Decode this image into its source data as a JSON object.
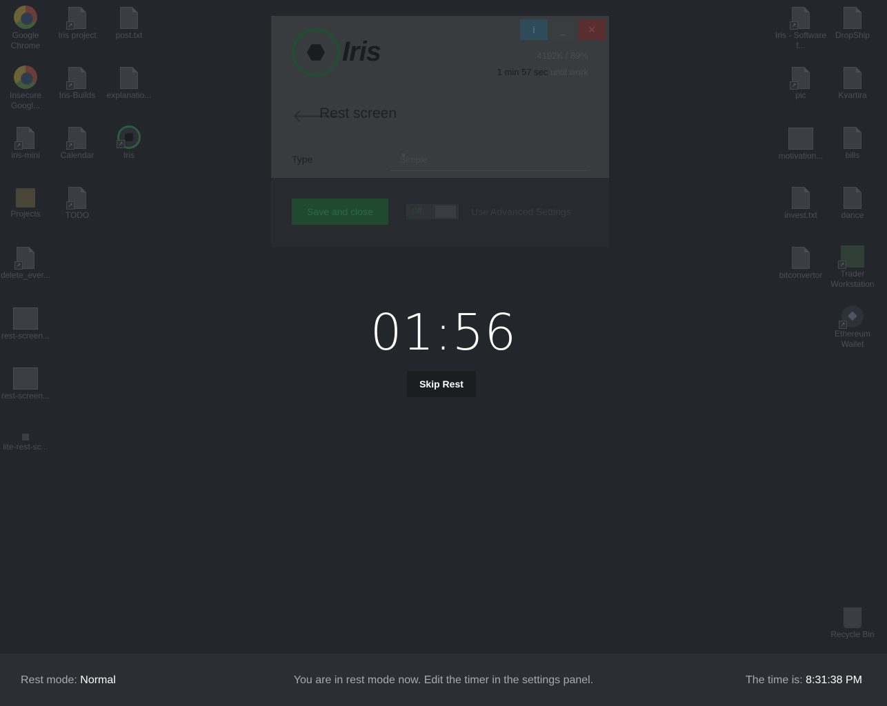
{
  "desktop": {
    "left_icons": [
      {
        "label": "Google Chrome",
        "type": "chrome",
        "shortcut": false
      },
      {
        "label": "Iris project",
        "type": "file",
        "shortcut": true
      },
      {
        "label": "post.txt",
        "type": "file",
        "shortcut": false
      },
      {
        "label": "Insecure Googl...",
        "type": "chrome",
        "shortcut": false
      },
      {
        "label": "Iris-Builds",
        "type": "file",
        "shortcut": true
      },
      {
        "label": "explanatio...",
        "type": "file",
        "shortcut": false
      },
      {
        "label": "iris-mini",
        "type": "file",
        "shortcut": true
      },
      {
        "label": "Calendar",
        "type": "file",
        "shortcut": true
      },
      {
        "label": "Iris",
        "type": "iris",
        "shortcut": true
      },
      {
        "label": "Projects",
        "type": "folder",
        "shortcut": false
      },
      {
        "label": "TODO",
        "type": "file",
        "shortcut": true
      },
      {
        "label": "delete_ever...",
        "type": "file",
        "shortcut": true
      },
      {
        "label": "rest-screen...",
        "type": "screenshot",
        "shortcut": false
      },
      {
        "label": "rest-screen...",
        "type": "screenshot",
        "shortcut": false
      },
      {
        "label": "lite-rest-sc...",
        "type": "tiny",
        "shortcut": false
      }
    ],
    "right_icons": [
      {
        "label": "Iris - Software f...",
        "type": "file",
        "shortcut": true
      },
      {
        "label": "DropShip",
        "type": "file",
        "shortcut": false
      },
      {
        "label": "pic",
        "type": "file",
        "shortcut": true
      },
      {
        "label": "Kvartira",
        "type": "file",
        "shortcut": false
      },
      {
        "label": "motivation...",
        "type": "screenshot",
        "shortcut": false
      },
      {
        "label": "bills",
        "type": "file",
        "shortcut": false
      },
      {
        "label": "invest.txt",
        "type": "file",
        "shortcut": false
      },
      {
        "label": "dance",
        "type": "file",
        "shortcut": false
      },
      {
        "label": "bitconvertor",
        "type": "file",
        "shortcut": false
      },
      {
        "label": "Trader Workstation",
        "type": "tws",
        "shortcut": true
      },
      {
        "label": "Ethereum Wallet",
        "type": "eth",
        "shortcut": true
      },
      {
        "label": "Recycle Bin",
        "type": "bin",
        "shortcut": false
      }
    ]
  },
  "iris_window": {
    "info_button": "i",
    "minimize_button": "_",
    "close_button": "✕",
    "logo_text": "Iris",
    "usage": "4192K / 89%",
    "countdown_time": "1 min 57 sec",
    "countdown_suffix": "until work",
    "back_arrow": "🡐",
    "title": "Rest screen",
    "type_label": "Type",
    "type_value": "Simple",
    "save_button": "Save and close",
    "toggle_label": "Off",
    "advanced_label": "Use Advanced Settings"
  },
  "rest": {
    "timer": "01:56",
    "skip_button": "Skip Rest"
  },
  "footer": {
    "mode_label": "Rest mode:",
    "mode_value": "Normal",
    "message": "You are in rest mode now. Edit the timer in the settings panel.",
    "time_label": "The time is:",
    "time_value": "8:31:38 PM"
  }
}
